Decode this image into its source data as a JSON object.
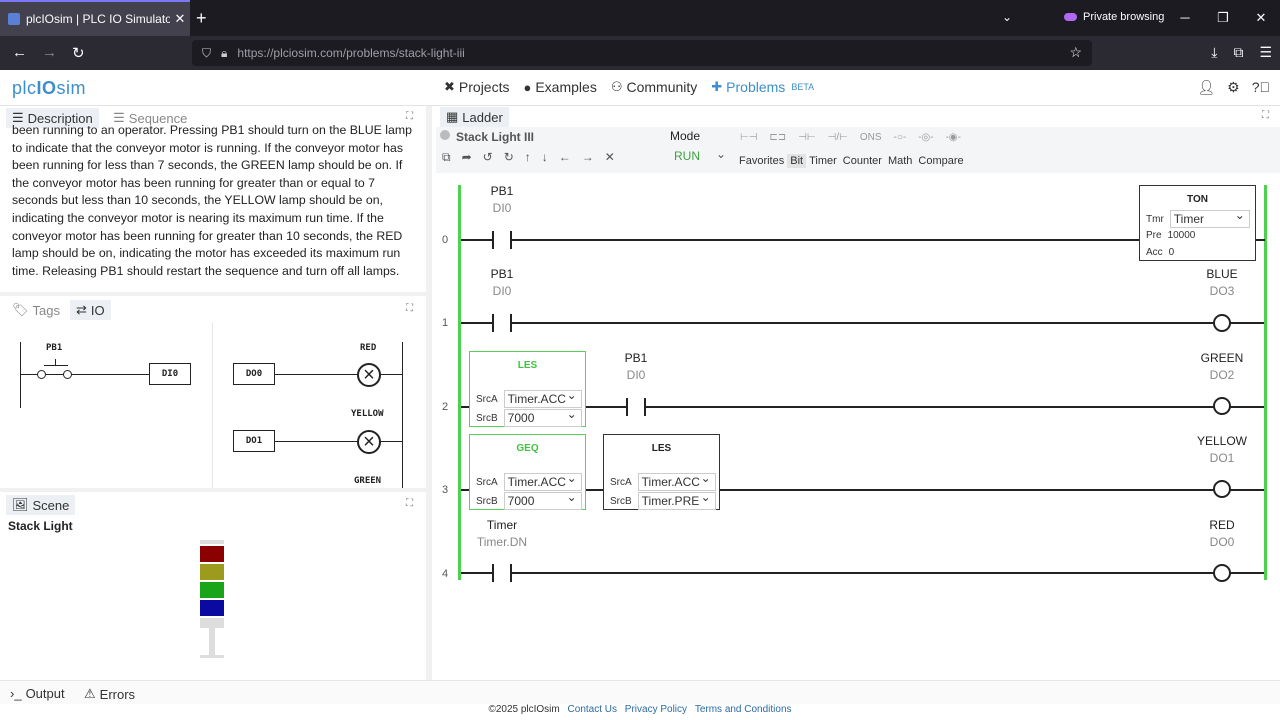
{
  "browser": {
    "tab_title": "plcIOsim | PLC IO Simulator",
    "url": "https://plciosim.com/problems/stack-light-iii",
    "private_label": "Private browsing"
  },
  "app": {
    "logo_a": "plc",
    "logo_b": "IO",
    "logo_c": "sim",
    "nav": [
      "Projects",
      "Examples",
      "Community",
      "Problems"
    ],
    "beta": "BETA"
  },
  "desc": {
    "tab_description": "Description",
    "tab_sequence": "Sequence",
    "text": "been running to an operator. Pressing PB1 should turn on the BLUE lamp to indicate that the conveyor motor is running. If the conveyor motor has been running for less than 7 seconds, the GREEN lamp should be on. If the conveyor motor has been running for greater than or equal to 7 seconds but less than 10 seconds, the YELLOW lamp should be on, indicating the conveyor motor is nearing its maximum run time. If the conveyor motor has been running for greater than 10 seconds, the RED lamp should be on, indicating the motor has exceeded its maximum run time. Releasing PB1 should restart the sequence and turn off all lamps."
  },
  "io": {
    "tab_tags": "Tags",
    "tab_io": "IO",
    "pb1": "PB1",
    "di0": "DI0",
    "do0": "DO0",
    "do1": "DO1",
    "red": "RED",
    "yellow": "YELLOW",
    "green": "GREEN"
  },
  "scene": {
    "tab": "Scene",
    "title": "Stack Light",
    "lamp_colors": [
      "#8b0000",
      "#9c9b1e",
      "#1aa41a",
      "#0a0aa0"
    ]
  },
  "bottom": {
    "output": "Output",
    "errors": "Errors",
    "copyright": "©2025 plcIOsim",
    "links": [
      "Contact Us",
      "Privacy Policy",
      "Terms and Conditions"
    ]
  },
  "ladder": {
    "tab": "Ladder",
    "program": "Stack Light III",
    "mode_label": "Mode",
    "mode_value": "RUN",
    "instr_tabs": [
      "Favorites",
      "Bit",
      "Timer",
      "Counter",
      "Math",
      "Compare"
    ],
    "ons": "ONS",
    "rungs": {
      "r0": {
        "num": "0",
        "tag": "PB1",
        "addr": "DI0"
      },
      "r1": {
        "num": "1",
        "tag": "PB1",
        "addr": "DI0",
        "coil_tag": "BLUE",
        "coil_addr": "DO3"
      },
      "r2": {
        "num": "2",
        "tag": "PB1",
        "addr": "DI0",
        "coil_tag": "GREEN",
        "coil_addr": "DO2"
      },
      "r3": {
        "num": "3",
        "coil_tag": "YELLOW",
        "coil_addr": "DO1"
      },
      "r4": {
        "num": "4",
        "tag": "Timer",
        "addr": "Timer.DN",
        "coil_tag": "RED",
        "coil_addr": "DO0"
      }
    },
    "ton": {
      "title": "TON",
      "tmr_label": "Tmr",
      "tmr": "Timer",
      "pre_label": "Pre",
      "pre": "10000",
      "acc_label": "Acc",
      "acc": "0"
    },
    "les1": {
      "title": "LES",
      "srca_label": "SrcA",
      "srca": "Timer.ACC",
      "srcb_label": "SrcB",
      "srcb": "7000"
    },
    "geq": {
      "title": "GEQ",
      "srca_label": "SrcA",
      "srca": "Timer.ACC",
      "srcb_label": "SrcB",
      "srcb": "7000"
    },
    "les2": {
      "title": "LES",
      "srca_label": "SrcA",
      "srca": "Timer.ACC",
      "srcb_label": "SrcB",
      "srcb": "Timer.PRE"
    }
  }
}
